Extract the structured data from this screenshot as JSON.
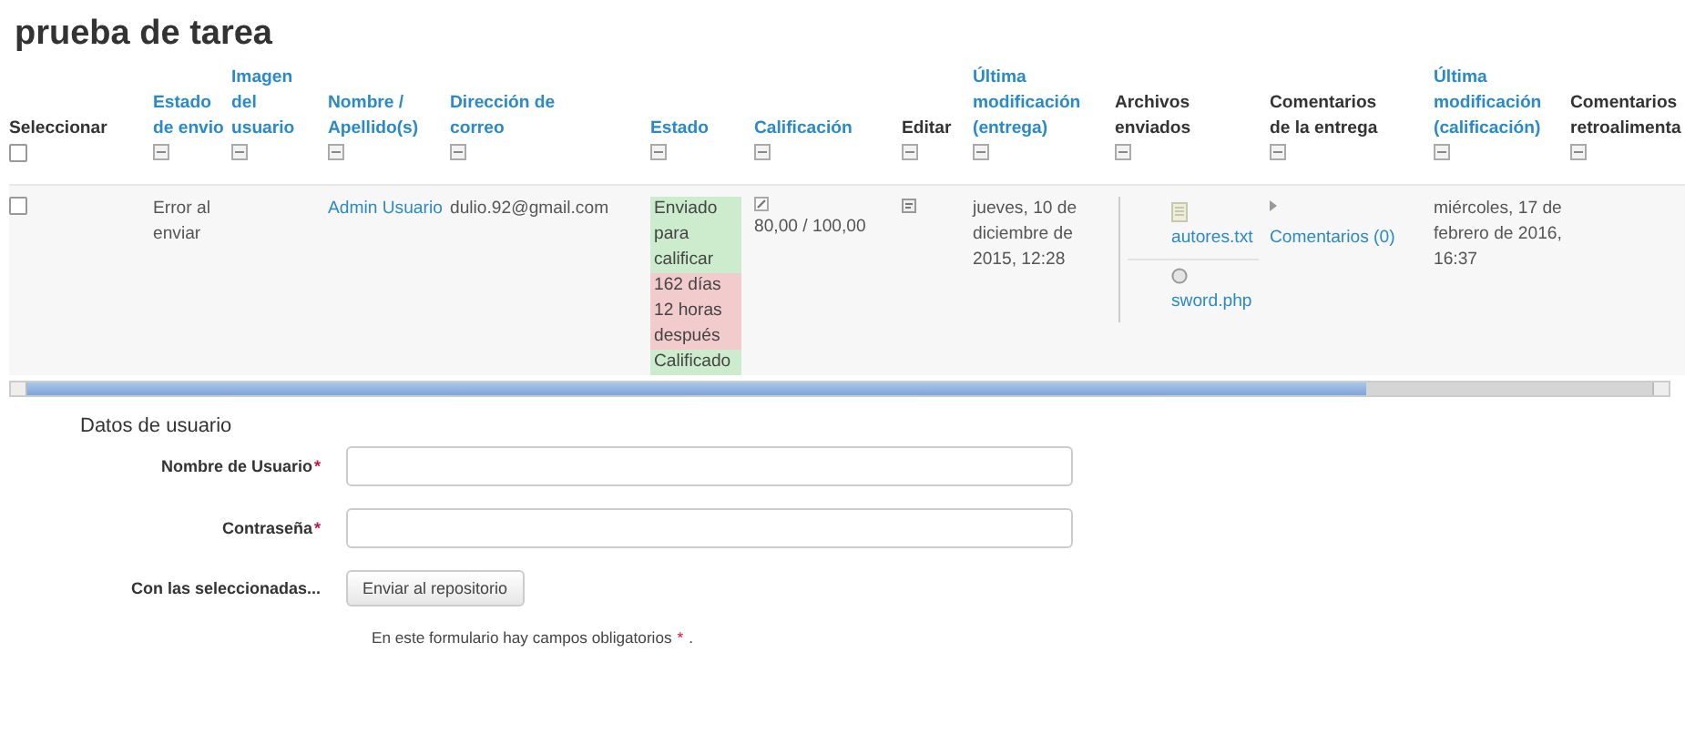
{
  "title": "prueba de tarea",
  "table": {
    "columns": [
      {
        "label": "Seleccionar",
        "kind": "select",
        "link": false
      },
      {
        "label": "Estado de envio",
        "kind": "collapsible",
        "link": true
      },
      {
        "label": "Imagen del usuario",
        "kind": "collapsible",
        "link": true
      },
      {
        "label": "Nombre / Apellido(s)",
        "kind": "collapsible",
        "link": true
      },
      {
        "label": "Dirección de correo",
        "kind": "collapsible",
        "link": true
      },
      {
        "label": "Estado",
        "kind": "collapsible",
        "link": true
      },
      {
        "label": "Calificación",
        "kind": "collapsible",
        "link": true
      },
      {
        "label": "Editar",
        "kind": "collapsible",
        "link": false
      },
      {
        "label": "Última modificación (entrega)",
        "kind": "collapsible",
        "link": true
      },
      {
        "label": "Archivos enviados",
        "kind": "collapsible",
        "link": false
      },
      {
        "label": "Comentarios de la entrega",
        "kind": "collapsible",
        "link": false
      },
      {
        "label": "Última modificación (calificación)",
        "kind": "collapsible",
        "link": true
      },
      {
        "label": "Comentarios retroalimenta",
        "kind": "collapsible",
        "link": false
      }
    ],
    "select_all": {
      "checked": false
    },
    "rows": [
      {
        "checked": false,
        "submission_status": "Error al enviar",
        "name": "Admin Usuario",
        "email": "dulio.92@gmail.com",
        "status": [
          {
            "text": "Enviado para calificar",
            "color": "#cdeccd"
          },
          {
            "text": "162 días 12 horas después",
            "color": "#f2cccc"
          },
          {
            "text": "Calificado",
            "color": "#cdeccd"
          }
        ],
        "grade": "80,00 / 100,00",
        "modified": "jueves, 10 de diciembre de 2015, 12:28",
        "files": [
          {
            "name": "autores.txt",
            "kind": "text"
          },
          {
            "name": "sword.php",
            "kind": "code"
          }
        ],
        "comments": "Comentarios (0)",
        "graded": "miércoles, 17 de febrero de 2016, 16:37"
      }
    ]
  },
  "form": {
    "legend": "Datos de usuario",
    "required_mark": "*",
    "fields": [
      {
        "label": "Nombre de Usuario",
        "required": true
      },
      {
        "label": "Contraseña",
        "required": true
      }
    ],
    "action_label": "Con las seleccionadas...",
    "button": "Enviar al repositorio",
    "note": "En este formulario hay campos obligatorios",
    "note_end": "."
  }
}
